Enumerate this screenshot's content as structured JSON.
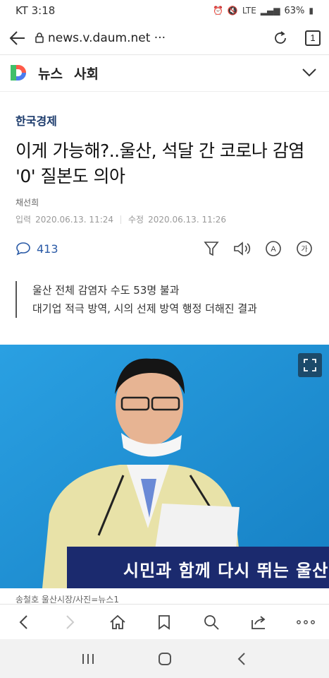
{
  "status_bar": {
    "carrier_time": "KT 3:18",
    "network": "LTE",
    "battery": "63%"
  },
  "browser": {
    "url": "news.v.daum.net ···",
    "tab_count": "1"
  },
  "header": {
    "news_label": "뉴스",
    "section_label": "사회"
  },
  "article": {
    "press": "한국경제",
    "headline": "이게 가능해?..울산, 석달 간 코로나 감염 '0' 질본도 의아",
    "reporter": "채선희",
    "published_label": "입력",
    "published": "2020.06.13. 11:24",
    "modified_label": "수정",
    "modified": "2020.06.13. 11:26",
    "comment_count": "413",
    "summary": [
      "울산 전체 감염자 수도 53명 불과",
      "대기업 적극 방역, 시의 선제 방역 행정 더해진 결과"
    ],
    "photo_banner": "시민과 함께 다시 뛰는 울산",
    "photo_caption": "송철호 울산시장/사진=뉴스1"
  },
  "icons": {
    "back": "back-arrow-icon",
    "lock": "lock-icon",
    "reload": "reload-icon",
    "comment": "comment-icon",
    "recommend": "recommend-icon",
    "audio": "audio-icon",
    "translate": "translate-icon",
    "font": "font-size-icon",
    "expand": "expand-icon"
  },
  "colors": {
    "press": "#1b3a6b",
    "accent": "#2a5aa6",
    "photo_bg": "#1e95d6",
    "banner": "#1b2a6e"
  }
}
